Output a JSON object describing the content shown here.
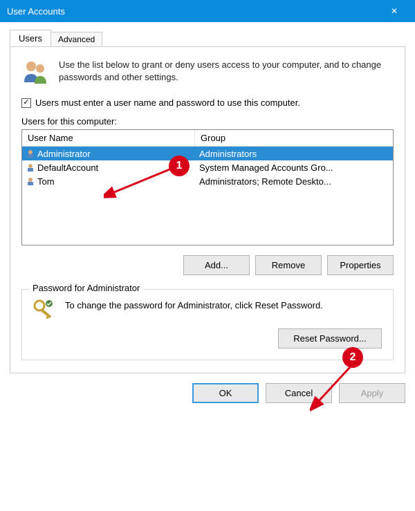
{
  "window": {
    "title": "User Accounts",
    "close_glyph": "✕"
  },
  "tabs": {
    "users": "Users",
    "advanced": "Advanced"
  },
  "intro_text": "Use the list below to grant or deny users access to your computer, and to change passwords and other settings.",
  "checkbox": {
    "checked_glyph": "✓",
    "label": "Users must enter a user name and password to use this computer."
  },
  "userlist": {
    "heading": "Users for this computer:",
    "columns": {
      "user": "User Name",
      "group": "Group"
    },
    "rows": [
      {
        "user": "Administrator",
        "group": "Administrators",
        "selected": true
      },
      {
        "user": "DefaultAccount",
        "group": "System Managed Accounts Gro...",
        "selected": false
      },
      {
        "user": "Tom",
        "group": "Administrators; Remote Deskto...",
        "selected": false
      }
    ]
  },
  "buttons": {
    "add": "Add...",
    "remove": "Remove",
    "properties": "Properties",
    "reset": "Reset Password...",
    "ok": "OK",
    "cancel": "Cancel",
    "apply": "Apply"
  },
  "password_group": {
    "legend": "Password for Administrator",
    "text": "To change the password for Administrator, click Reset Password."
  },
  "annotations": {
    "n1": "1",
    "n2": "2"
  }
}
